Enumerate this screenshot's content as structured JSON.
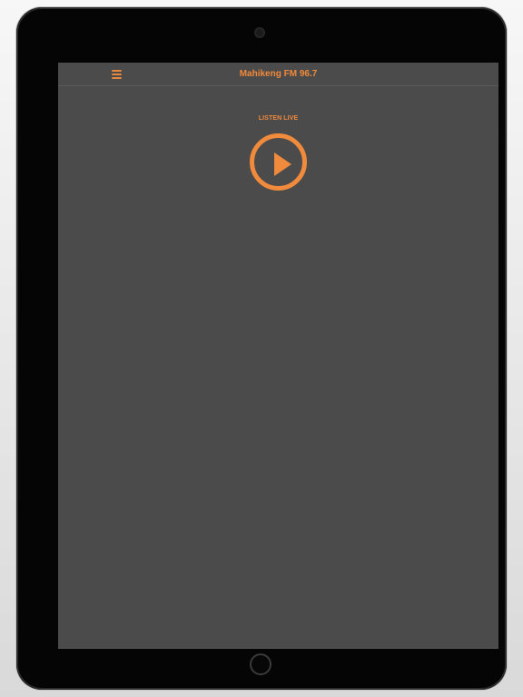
{
  "header": {
    "title": "Mahikeng FM 96.7",
    "menu_icon": "hamburger-menu-icon"
  },
  "player": {
    "listen_label": "LISTEN LIVE",
    "play_icon": "play-icon"
  },
  "colors": {
    "accent": "#f08a3c",
    "background": "#4b4b4b",
    "bezel": "#050505"
  }
}
